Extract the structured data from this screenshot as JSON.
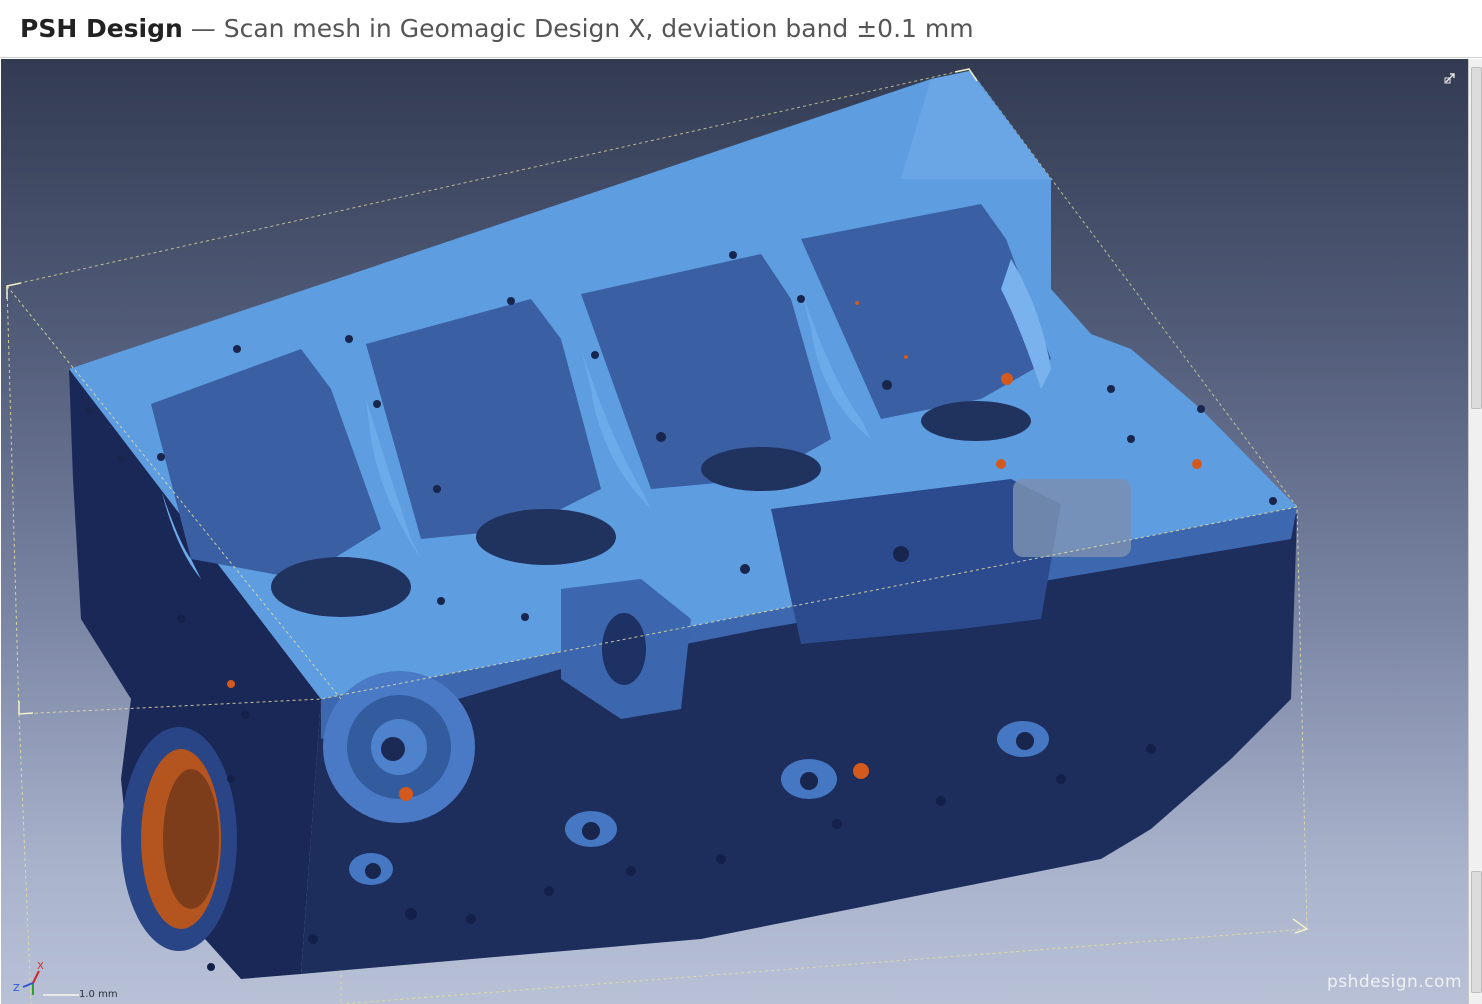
{
  "header": {
    "brand": "PSH Design",
    "caption": " — Scan mesh in Geomagic Design X, deviation band ±0.1 mm"
  },
  "viewport": {
    "object": "engine-block-scan-mesh",
    "mesh_color": "#5d9de0",
    "mesh_shadow_color": "#1c2c5a",
    "deviation_color": "#d35a1c",
    "bbox_color": "#e6e0a0",
    "expand_icon": "expand-icon",
    "scale_label": "1.0 mm",
    "axis_labels": {
      "x": "X",
      "z": "Z"
    },
    "watermark": "pshdesign.com"
  },
  "colors": {
    "background_top": "#323b52",
    "background_bottom": "#b8c1d6"
  }
}
